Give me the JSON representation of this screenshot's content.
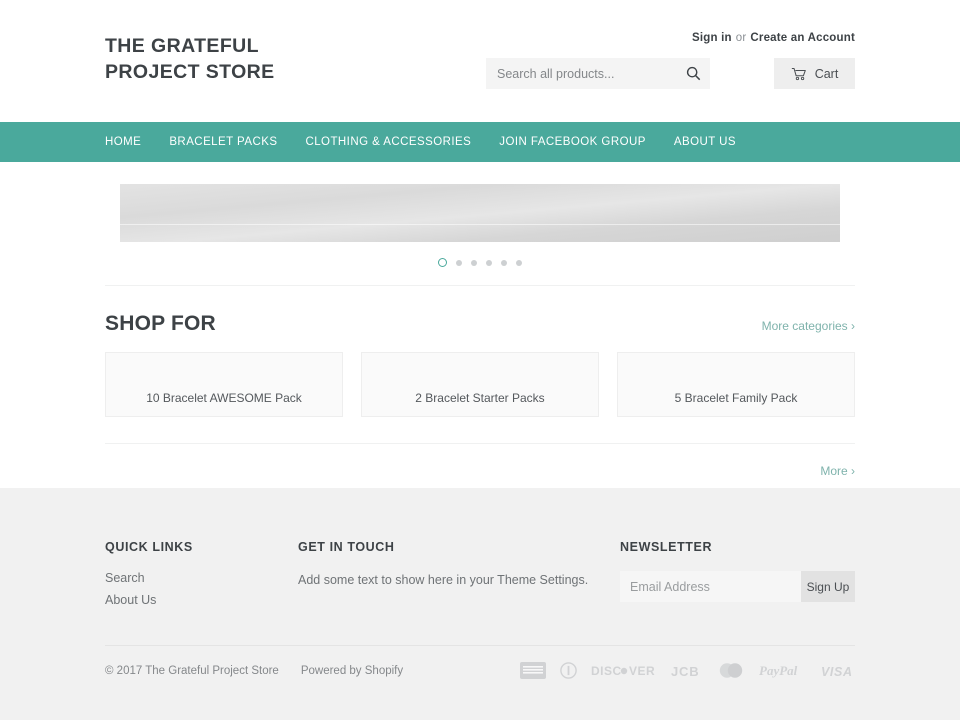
{
  "header": {
    "logo_line1": "THE GRATEFUL",
    "logo_line2": "PROJECT STORE",
    "sign_in": "Sign in",
    "or": "or",
    "create_account": "Create an Account",
    "search_placeholder": "Search all products...",
    "search_value": "",
    "search_icon": "search-icon",
    "cart_label": "Cart",
    "cart_icon": "shopping-cart-icon"
  },
  "nav": {
    "items": [
      {
        "label": "Home"
      },
      {
        "label": "Bracelet Packs"
      },
      {
        "label": "Clothing & Accessories"
      },
      {
        "label": "Join Facebook Group"
      },
      {
        "label": "About Us"
      }
    ]
  },
  "slider": {
    "dots_total": 6,
    "active_dot": 1
  },
  "shop_for": {
    "title": "Shop For",
    "more_categories": "More categories ›",
    "more": "More ›",
    "cards": [
      {
        "label": "10 Bracelet AWESOME Pack"
      },
      {
        "label": "2 Bracelet Starter Packs"
      },
      {
        "label": "5 Bracelet Family Pack"
      }
    ]
  },
  "footer": {
    "quick_links_title": "Quick Links",
    "quick_links": [
      {
        "label": "Search"
      },
      {
        "label": "About Us"
      }
    ],
    "get_in_touch_title": "Get in touch",
    "get_in_touch_text": "Add some text to show here in your Theme Settings.",
    "newsletter_title": "Newsletter",
    "newsletter_placeholder": "Email Address",
    "newsletter_value": "",
    "signup_label": "Sign Up",
    "copyright": "© 2017 The Grateful Project Store",
    "powered_by": "Powered by Shopify",
    "payment_icons": [
      {
        "name": "american-express-icon",
        "label": "AMERICAN EXPRESS"
      },
      {
        "name": "diners-club-icon",
        "label": "Diners Club"
      },
      {
        "name": "discover-icon",
        "label": "DISCOVER"
      },
      {
        "name": "jcb-icon",
        "label": "JCB"
      },
      {
        "name": "mastercard-icon",
        "label": "Mastercard"
      },
      {
        "name": "paypal-icon",
        "label": "PayPal"
      },
      {
        "name": "visa-icon",
        "label": "VISA"
      }
    ]
  },
  "colors": {
    "accent_teal": "#4aa99c",
    "link_teal": "#7fb3ac",
    "footer_bg": "#f1f1f1",
    "text_dark": "#3d4246"
  }
}
